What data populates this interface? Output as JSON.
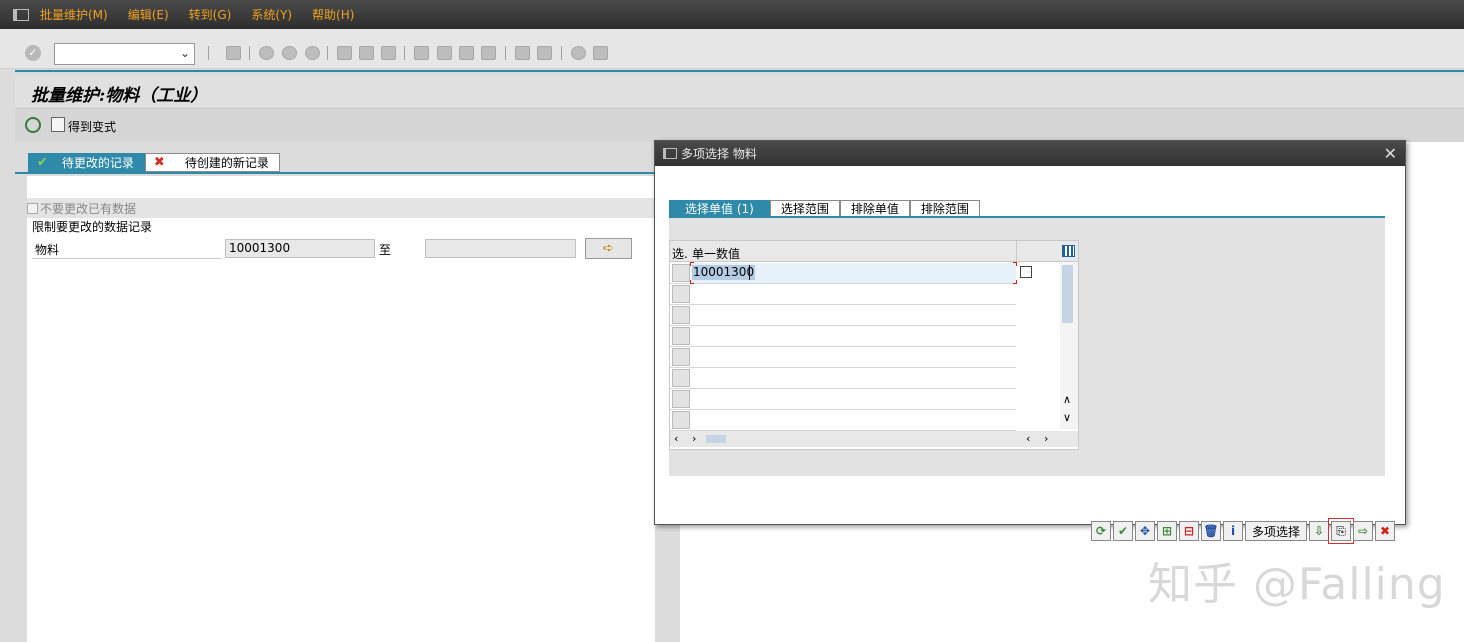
{
  "menubar": {
    "items": [
      "批量维护(M)",
      "编辑(E)",
      "转到(G)",
      "系统(Y)",
      "帮助(H)"
    ]
  },
  "page": {
    "title": "批量维护:物料（工业）",
    "get_variant": "得到变式"
  },
  "tabs": {
    "pending": "待更改的记录",
    "new": "待创建的新记录"
  },
  "form": {
    "checkbox_label": "不要更改已有数据",
    "section_title": "限制要更改的数据记录",
    "material_label": "物料",
    "material_from": "10001300",
    "to_label": "至",
    "material_to": ""
  },
  "dialog": {
    "title": "多项选择 物料",
    "tabs": [
      "选择单值 (1)",
      "选择范围",
      "排除单值",
      "排除范围"
    ],
    "table": {
      "sel_header": "选.",
      "col_header": "单一数值",
      "rows": [
        "10001300",
        "",
        "",
        "",
        "",
        "",
        "",
        ""
      ]
    },
    "footer": {
      "multi_select": "多项选择"
    }
  },
  "watermark": "知乎 @Falling",
  "colors": {
    "accent": "#2e8aa8",
    "menu_text": "#f0a020",
    "cancel": "#d02020"
  }
}
